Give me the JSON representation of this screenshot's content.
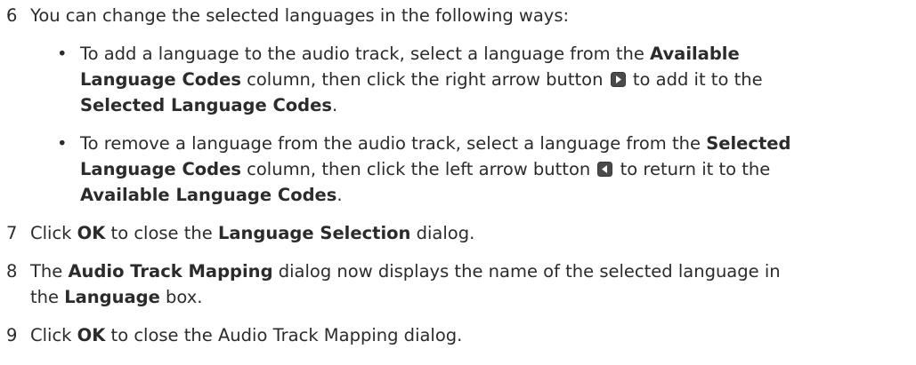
{
  "step6": {
    "number": "6",
    "text": "You can change the selected languages in the following ways:",
    "bullets": [
      {
        "marker": "•",
        "line1_a": "To add a language to the audio track, select a language from the ",
        "line1_b": "Available",
        "line2_a": "Language Codes",
        "line2_b": " column, then click the right arrow button ",
        "line2_c": " to add it to the",
        "line3_a": "Selected Language Codes",
        "line3_b": ".",
        "icon": "right-arrow-button-icon"
      },
      {
        "marker": "•",
        "line1_a": "To remove a language from the audio track, select a language from the ",
        "line1_b": "Selected",
        "line2_a": "Language Codes",
        "line2_b": " column, then click the left arrow button ",
        "line2_c": " to return it to the",
        "line3_a": "Available Language Codes",
        "line3_b": ".",
        "icon": "left-arrow-button-icon"
      }
    ]
  },
  "step7": {
    "number": "7",
    "a": "Click ",
    "b": "OK",
    "c": " to close the ",
    "d": "Language Selection",
    "e": " dialog."
  },
  "step8": {
    "number": "8",
    "a": "The ",
    "b": "Audio Track Mapping",
    "c": " dialog now displays the name of the selected language in",
    "d": "the ",
    "e": "Language",
    "f": " box."
  },
  "step9": {
    "number": "9",
    "a": "Click ",
    "b": "OK",
    "c": " to close the Audio Track Mapping dialog."
  },
  "colors": {
    "text": "#2b2b2b",
    "icon_fill": "#4a4a4a",
    "icon_arrow": "#ffffff"
  }
}
